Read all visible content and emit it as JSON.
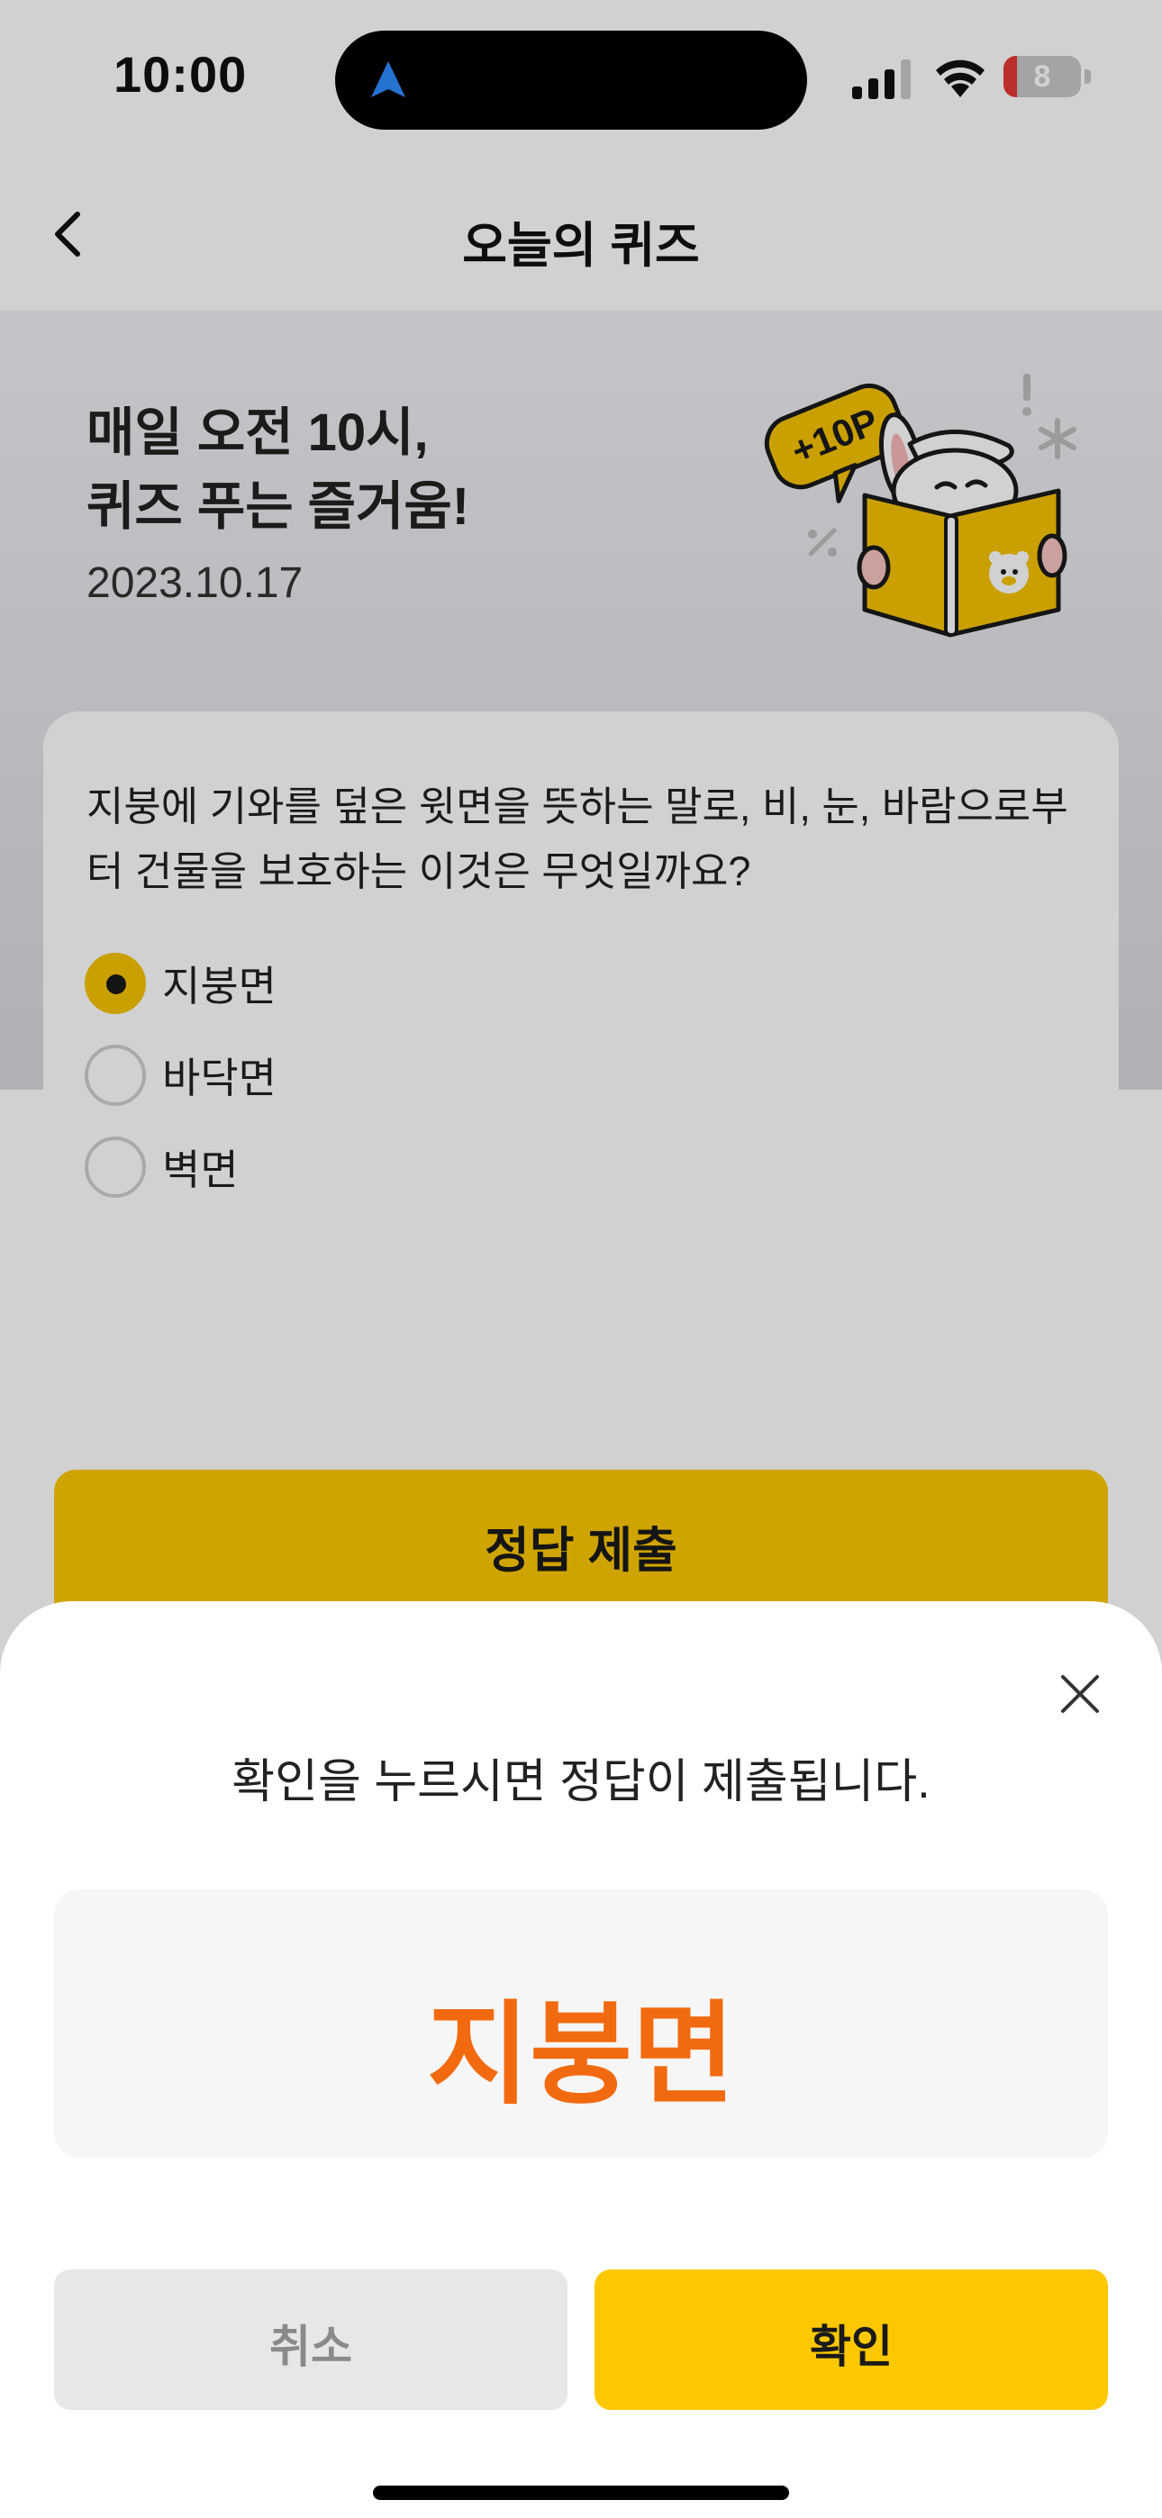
{
  "status_bar": {
    "time": "10:00",
    "battery": "8",
    "battery_level": 0.08
  },
  "header": {
    "title": "오늘의 퀴즈"
  },
  "hero": {
    "title_line1": "매일 오전 10시,",
    "title_line2": "퀴즈 푸는 즐거움!",
    "date": "2023.10.17",
    "badge": "+10P"
  },
  "quiz": {
    "question": "지붕에 기와를 덮은 윗면을 뜻하는 말로, 비, 눈, 바람으로부터 건물을 보호하는 이것은 무엇일까요?",
    "options": [
      {
        "label": "지붕면",
        "selected": true
      },
      {
        "label": "바닥면",
        "selected": false
      },
      {
        "label": "벽면",
        "selected": false
      }
    ],
    "submit_label": "정답 제출"
  },
  "sheet": {
    "message": "확인을 누르시면 정답이 제출됩니다.",
    "answer": "지붕면",
    "cancel_label": "취소",
    "confirm_label": "확인"
  },
  "colors": {
    "accent": "#fdc801",
    "answer": "#f26a0f"
  }
}
